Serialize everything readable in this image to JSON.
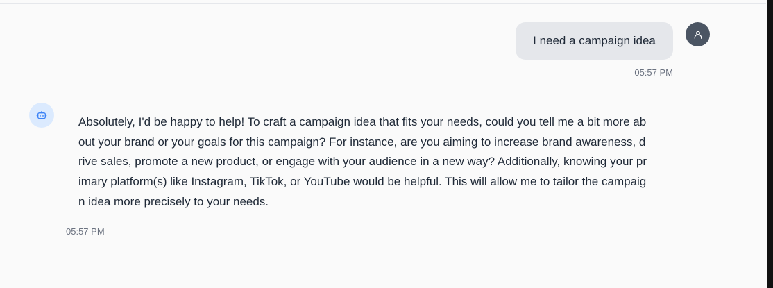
{
  "conversation": {
    "user_message": {
      "text": "I need a campaign idea",
      "time": "05:57 PM",
      "avatar_icon": "user-icon"
    },
    "bot_message": {
      "text": "Absolutely, I'd be happy to help! To craft a campaign idea that fits your needs, could you tell me a bit more about your brand or your goals for this campaign? For instance, are you aiming to increase brand awareness, drive sales, promote a new product, or engage with your audience in a new way? Additionally, knowing your primary platform(s) like Instagram, TikTok, or YouTube would be helpful. This will allow me to tailor the campaign idea more precisely to your needs.",
      "time": "05:57 PM",
      "avatar_icon": "bot-icon"
    }
  },
  "colors": {
    "user_bubble": "#e5e7eb",
    "user_avatar": "#4b5563",
    "bot_avatar_bg": "#dbeafe",
    "bot_icon": "#3b82f6",
    "timestamp": "#6b7280"
  }
}
